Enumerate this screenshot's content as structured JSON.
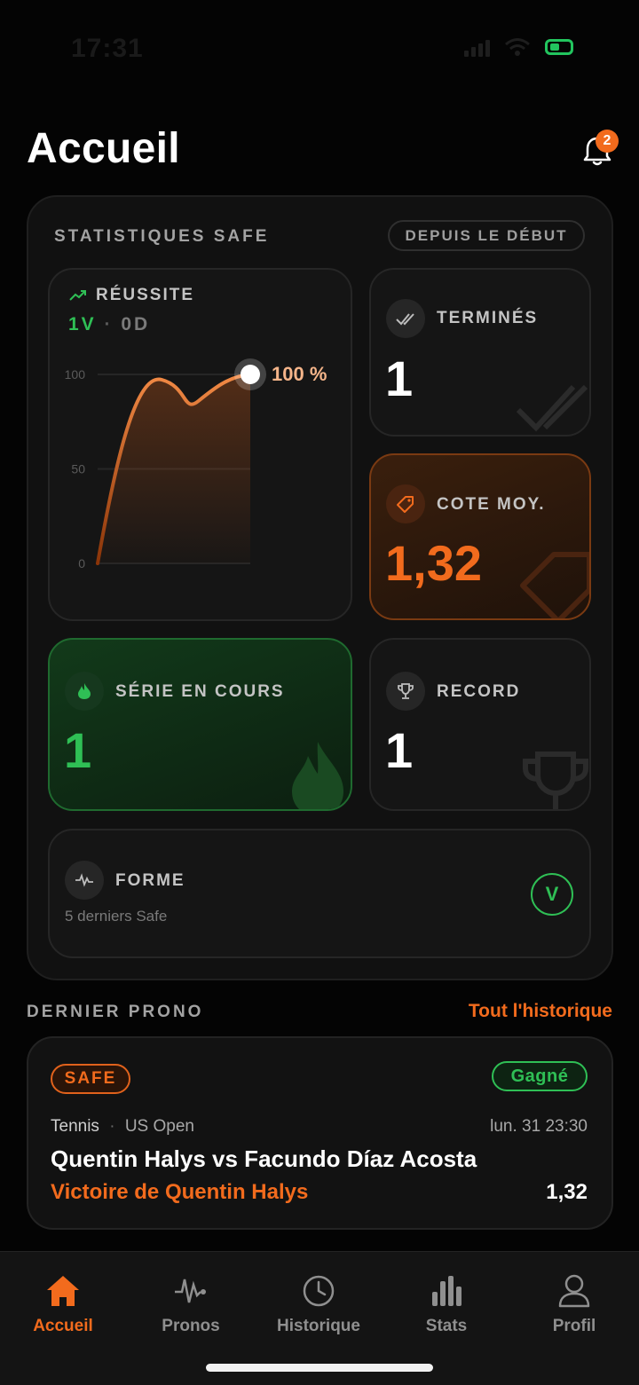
{
  "status": {
    "time": "17:31"
  },
  "header": {
    "title": "Accueil",
    "notifications_count": "2"
  },
  "stats": {
    "section_title": "STATISTIQUES SAFE",
    "period_pill": "DEPUIS LE DÉBUT",
    "success": {
      "label": "RÉUSSITE",
      "wins": "1V",
      "sep": "·",
      "draws": "0D",
      "percent_label": "100 %"
    },
    "finished": {
      "label": "TERMINÉS",
      "value": "1"
    },
    "avg_odds": {
      "label": "COTE MOY.",
      "value": "1,32"
    },
    "streak": {
      "label": "SÉRIE EN COURS",
      "value": "1"
    },
    "record": {
      "label": "RECORD",
      "value": "1"
    },
    "form": {
      "label": "FORME",
      "subtitle": "5 derniers Safe",
      "results": [
        "V"
      ]
    }
  },
  "chart_data": {
    "type": "line",
    "y_ticks": [
      "100",
      "50",
      "0"
    ],
    "ylim": [
      0,
      100
    ],
    "series": [
      {
        "values": [
          0,
          100
        ]
      }
    ],
    "end_label": "100 %"
  },
  "last_prono": {
    "section_title": "DERNIER PRONO",
    "link": "Tout l'historique",
    "type_badge": "SAFE",
    "status_badge": "Gagné",
    "sport": "Tennis",
    "dot": "·",
    "competition": "US Open",
    "date": "lun. 31 23:30",
    "match": "Quentin Halys vs Facundo Díaz Acosta",
    "pick": "Victoire de Quentin Halys",
    "odds": "1,32"
  },
  "tabs": [
    {
      "label": "Accueil",
      "icon": "home-icon",
      "active": true
    },
    {
      "label": "Pronos",
      "icon": "pulse-icon",
      "active": false
    },
    {
      "label": "Historique",
      "icon": "clock-icon",
      "active": false
    },
    {
      "label": "Stats",
      "icon": "bar-chart-icon",
      "active": false
    },
    {
      "label": "Profil",
      "icon": "user-icon",
      "active": false
    }
  ],
  "colors": {
    "accent": "#f26b1d",
    "success": "#2fbf55",
    "background": "#040404"
  }
}
